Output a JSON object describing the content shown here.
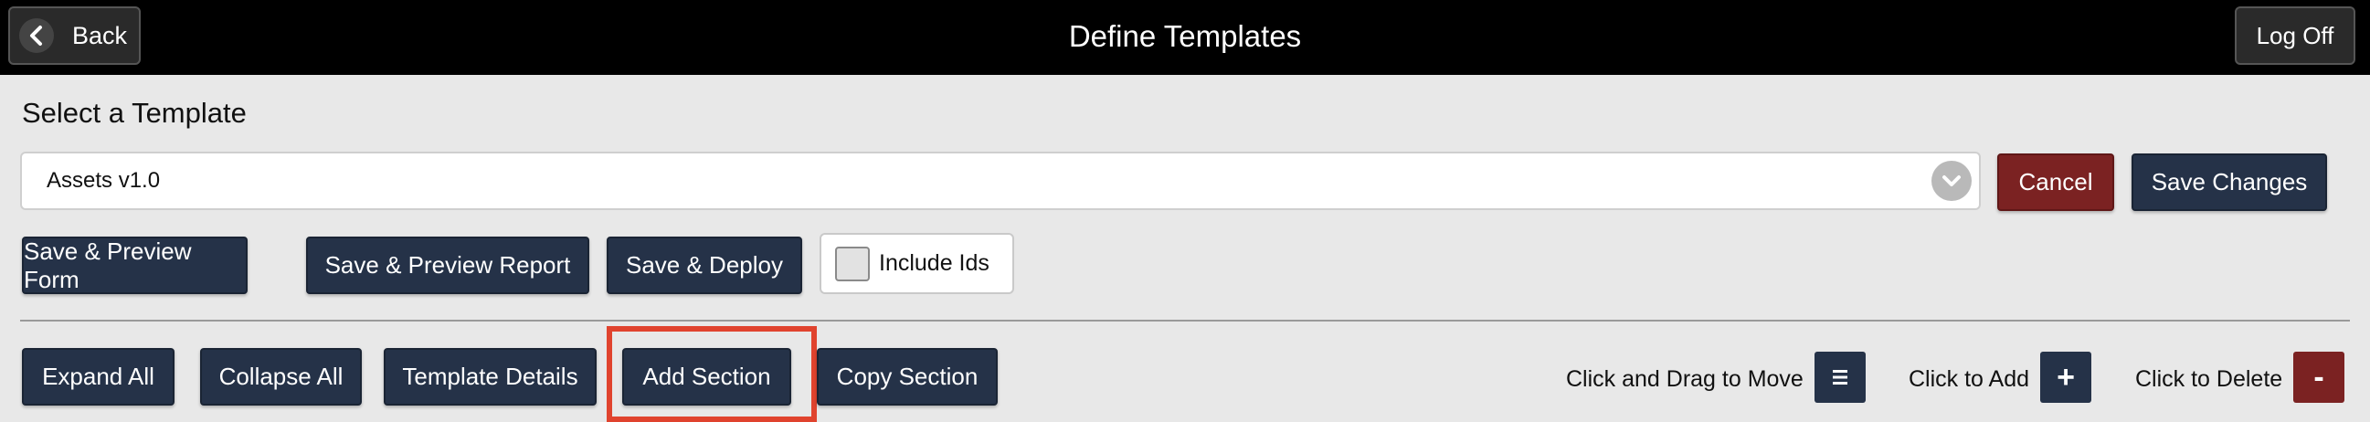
{
  "header": {
    "back_label": "Back",
    "title": "Define Templates",
    "logoff_label": "Log Off"
  },
  "template_select": {
    "label": "Select a Template",
    "value": "Assets v1.0",
    "cancel_label": "Cancel",
    "save_changes_label": "Save Changes"
  },
  "actions": {
    "save_preview_form": "Save & Preview Form",
    "save_preview_report": "Save & Preview Report",
    "save_deploy": "Save & Deploy",
    "include_ids_label": "Include Ids",
    "include_ids_checked": false
  },
  "section_toolbar": {
    "expand_all": "Expand All",
    "collapse_all": "Collapse All",
    "template_details": "Template Details",
    "add_section": "Add Section",
    "copy_section": "Copy Section"
  },
  "legend": {
    "move_label": "Click and Drag to Move",
    "move_icon": "hamburger-icon",
    "add_label": "Click to Add",
    "add_icon_text": "+",
    "delete_label": "Click to Delete",
    "delete_icon_text": "-"
  },
  "colors": {
    "header_bg": "#000000",
    "primary_button": "#253248",
    "danger_button": "#7b2222",
    "highlight": "#e0432e",
    "page_bg": "#e8e8e8"
  }
}
